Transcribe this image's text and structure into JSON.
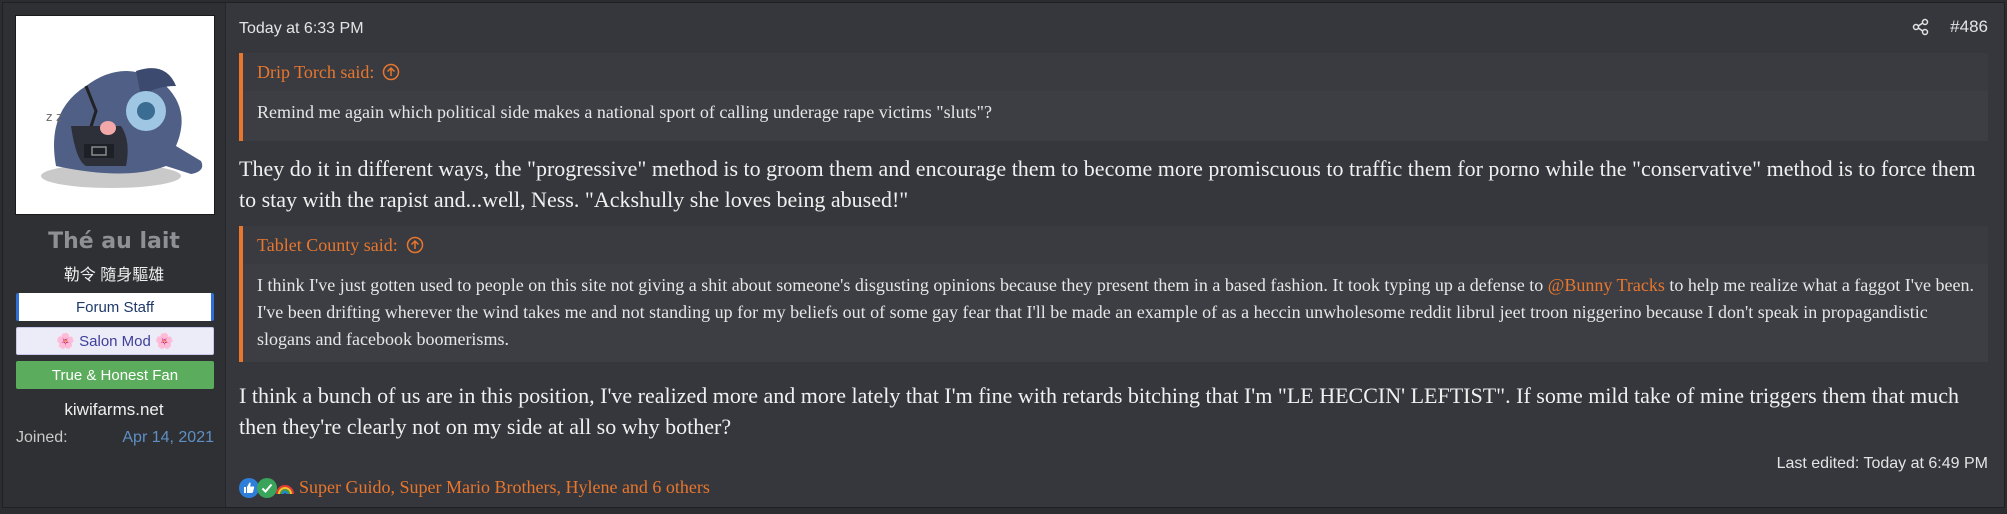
{
  "user": {
    "name": "Thé au lait",
    "title": "勒令 隨身驅雄",
    "banners": [
      "Forum Staff",
      "🌸 Salon Mod 🌸",
      "True & Honest Fan"
    ],
    "site": "kiwifarms.net",
    "joined_label": "Joined:",
    "joined_value": "Apr 14, 2021"
  },
  "post": {
    "date": "Today at 6:33 PM",
    "number": "#486",
    "quote1": {
      "author": "Drip Torch said:",
      "text": "Remind me again which political side makes a national sport of calling underage rape victims \"sluts\"?"
    },
    "para1": "They do it in different ways, the \"progressive\" method is to groom them and encourage them to become more promiscuous to traffic them for porno while the \"conservative\" method is to force them to stay with the rapist and...well, Ness. \"Ackshully she loves being abused!\"",
    "quote2": {
      "author": "Tablet County said:",
      "text_before": "I think I've just gotten used to people on this site not giving a shit about someone's disgusting opinions because they present them in a based fashion. It took typing up a defense to ",
      "mention": "@Bunny Tracks",
      "text_after": " to help me realize what a faggot I've been. I've been drifting wherever the wind takes me and not standing up for my beliefs out of some gay fear that I'll be made an example of as a heccin unwholesome reddit librul jeet troon niggerino because I don't speak in propagandistic slogans and facebook boomerisms."
    },
    "para2": "I think a bunch of us are in this position, I've realized more and more lately that I'm fine with retards bitching that I'm \"LE HECCIN' LEFTIST\". If some mild take of mine triggers them that much then they're clearly not on my side at all so why bother?",
    "edited": "Last edited: Today at 6:49 PM",
    "reactions": "Super Guido, Super Mario Brothers, Hylene and 6 others",
    "reaction_icons": [
      "thumbs-up-icon",
      "checkmark-icon",
      "rainbow-icon"
    ]
  },
  "colors": {
    "accent": "#e8762d",
    "link_blue": "#5f8fc4",
    "background": "#35373c"
  }
}
